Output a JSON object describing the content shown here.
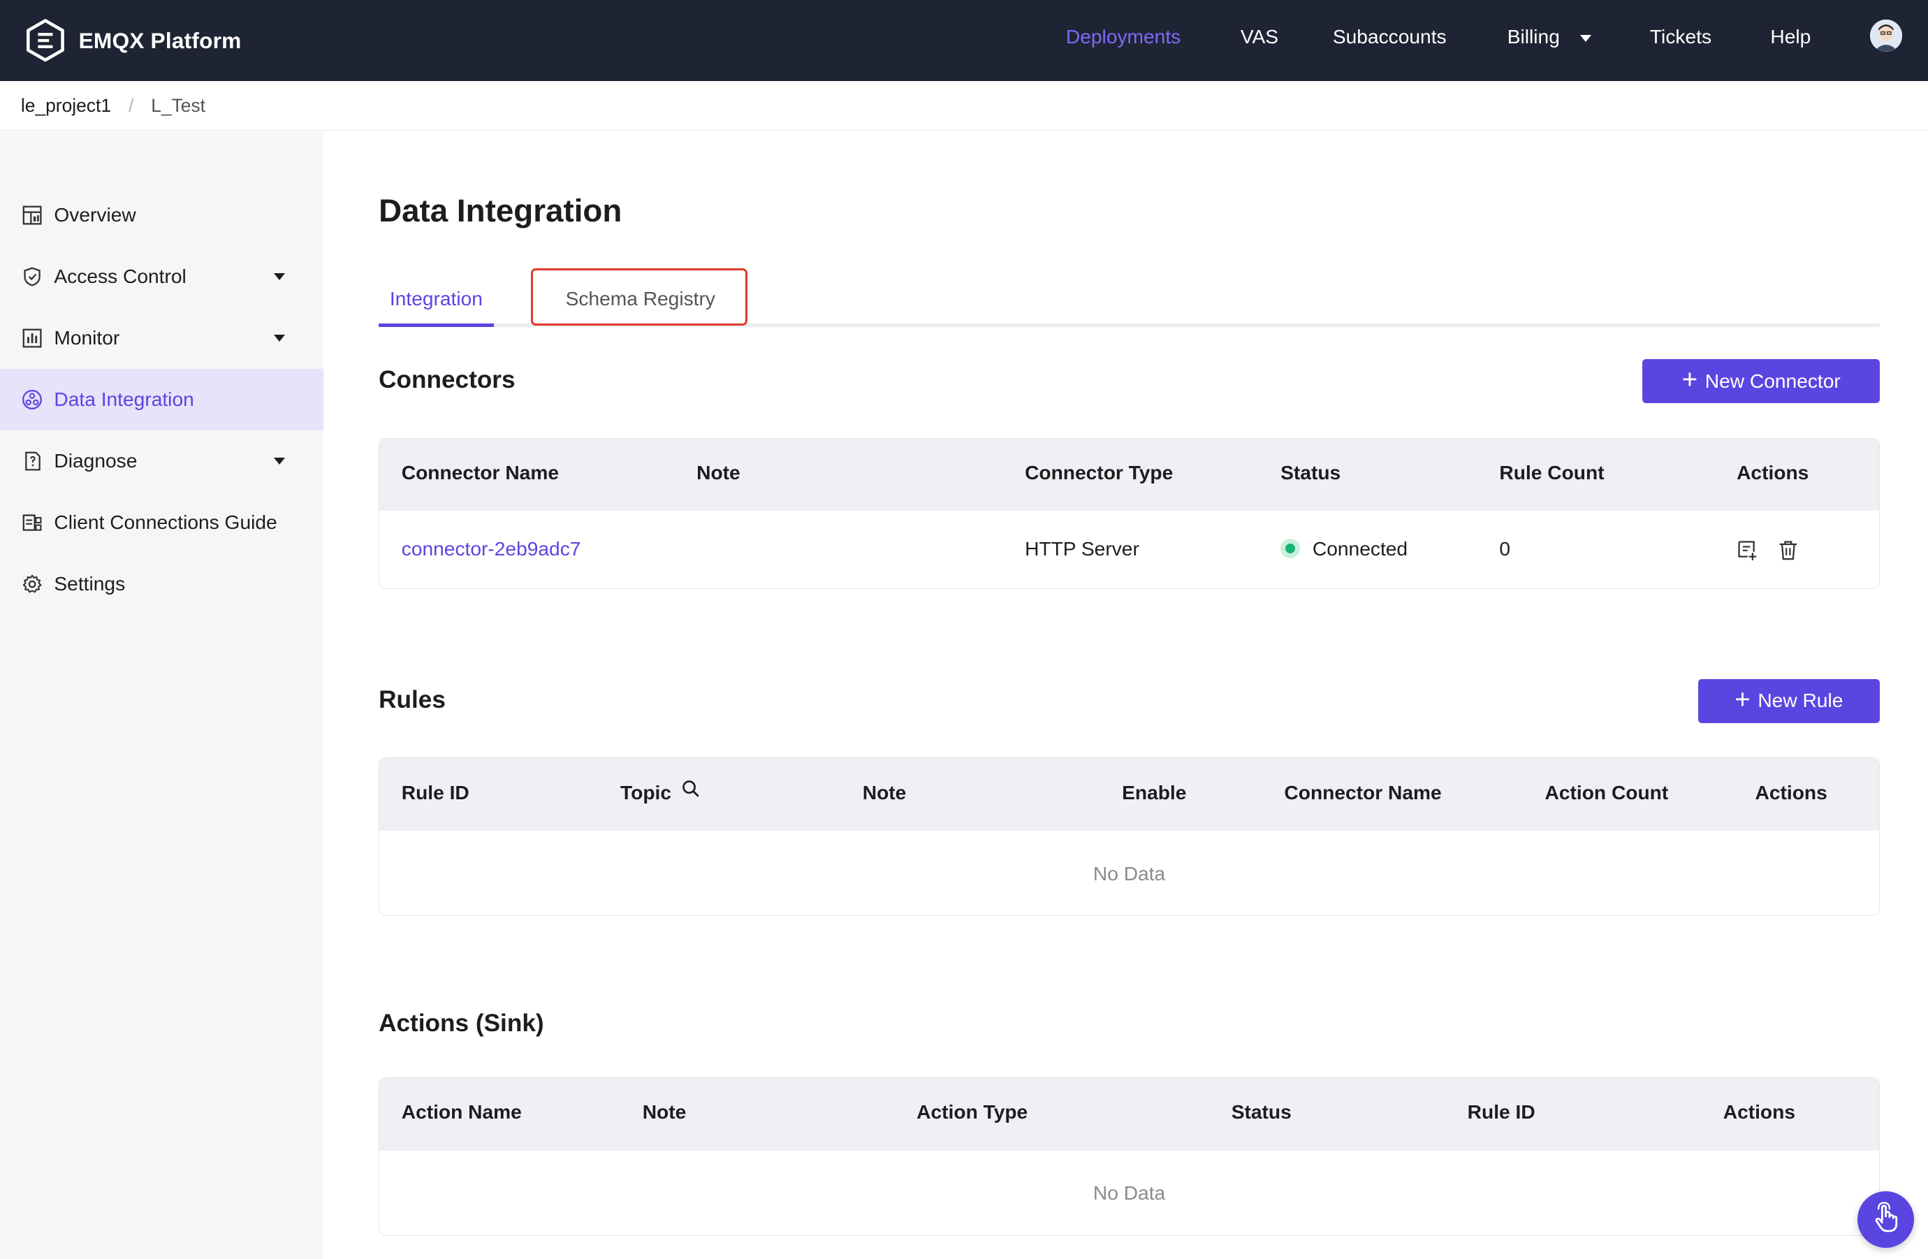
{
  "header": {
    "brand": "EMQX Platform",
    "nav": [
      {
        "label": "Deployments",
        "active": true
      },
      {
        "label": "VAS"
      },
      {
        "label": "Subaccounts"
      },
      {
        "label": "Billing",
        "has_dropdown": true
      },
      {
        "label": "Tickets"
      },
      {
        "label": "Help"
      }
    ]
  },
  "breadcrumb": [
    "le_project1",
    "L_Test"
  ],
  "sidebar": {
    "items": [
      {
        "label": "Overview",
        "icon": "dashboard-icon"
      },
      {
        "label": "Access Control",
        "icon": "shield-icon",
        "has_dropdown": true
      },
      {
        "label": "Monitor",
        "icon": "chart-icon",
        "has_dropdown": true
      },
      {
        "label": "Data Integration",
        "icon": "integration-icon",
        "active": true
      },
      {
        "label": "Diagnose",
        "icon": "diagnose-icon",
        "has_dropdown": true
      },
      {
        "label": "Client Connections Guide",
        "icon": "guide-icon"
      },
      {
        "label": "Settings",
        "icon": "gear-icon"
      }
    ]
  },
  "page": {
    "title": "Data Integration",
    "tabs": [
      {
        "label": "Integration",
        "active": true
      },
      {
        "label": "Schema Registry",
        "highlighted": true
      }
    ]
  },
  "connectors": {
    "title": "Connectors",
    "new_button": "New Connector",
    "columns": [
      "Connector Name",
      "Note",
      "Connector Type",
      "Status",
      "Rule Count",
      "Actions"
    ],
    "rows": [
      {
        "name": "connector-2eb9adc7",
        "note": "",
        "type": "HTTP Server",
        "status": "Connected",
        "rule_count": "0"
      }
    ]
  },
  "rules": {
    "title": "Rules",
    "new_button": "New Rule",
    "columns": [
      "Rule ID",
      "Topic",
      "Note",
      "Enable",
      "Connector Name",
      "Action Count",
      "Actions"
    ],
    "empty_text": "No Data"
  },
  "actions_sink": {
    "title": "Actions (Sink)",
    "columns": [
      "Action Name",
      "Note",
      "Action Type",
      "Status",
      "Rule ID",
      "Actions"
    ],
    "empty_text": "No Data"
  },
  "colors": {
    "accent": "#5b45e0",
    "topbar": "#1f2434",
    "status_connected": "#19b374",
    "highlight": "#e03a2e"
  }
}
